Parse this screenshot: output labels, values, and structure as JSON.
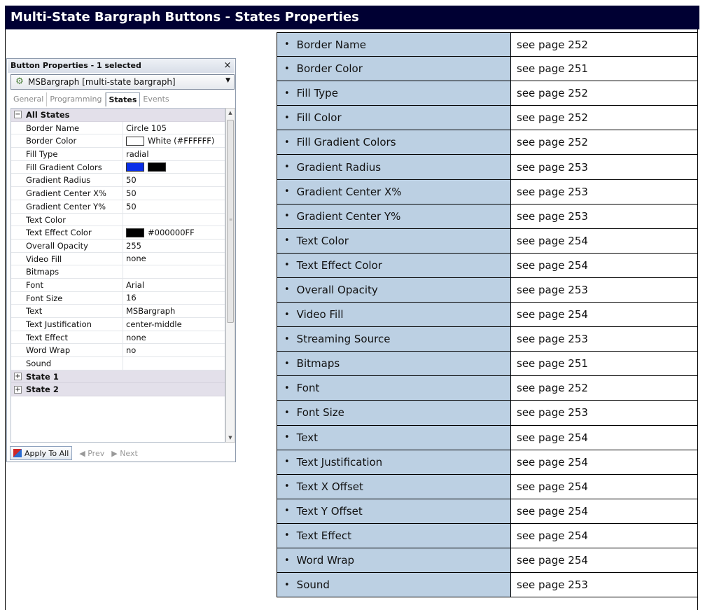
{
  "header": {
    "title": "Multi-State Bargraph Buttons - States Properties"
  },
  "properties_table": {
    "rows": [
      {
        "name": "Border Name",
        "ref": "see page 252"
      },
      {
        "name": "Border Color",
        "ref": "see page 251"
      },
      {
        "name": "Fill Type",
        "ref": "see page 252"
      },
      {
        "name": "Fill Color",
        "ref": "see page 252"
      },
      {
        "name": "Fill Gradient Colors",
        "ref": "see page 252"
      },
      {
        "name": "Gradient Radius",
        "ref": "see page 253"
      },
      {
        "name": "Gradient Center X%",
        "ref": "see page 253"
      },
      {
        "name": "Gradient Center Y%",
        "ref": "see page 253"
      },
      {
        "name": "Text Color",
        "ref": "see page 254"
      },
      {
        "name": "Text Effect Color",
        "ref": "see page 254"
      },
      {
        "name": "Overall Opacity",
        "ref": "see page 253"
      },
      {
        "name": "Video Fill",
        "ref": "see page 254"
      },
      {
        "name": "Streaming Source",
        "ref": "see page 253"
      },
      {
        "name": "Bitmaps",
        "ref": "see page 251"
      },
      {
        "name": "Font",
        "ref": "see page 252"
      },
      {
        "name": "Font Size",
        "ref": "see page 253"
      },
      {
        "name": "Text",
        "ref": "see page 254"
      },
      {
        "name": "Text Justification",
        "ref": "see page 254"
      },
      {
        "name": "Text X Offset",
        "ref": "see page 254"
      },
      {
        "name": "Text Y Offset",
        "ref": "see page 254"
      },
      {
        "name": "Text Effect",
        "ref": "see page 254"
      },
      {
        "name": "Word Wrap",
        "ref": "see page 254"
      },
      {
        "name": "Sound",
        "ref": "see page 253"
      }
    ]
  },
  "panel": {
    "title": "Button Properties - 1 selected",
    "close": "×",
    "dropdown": {
      "value": "MSBargraph  [multi-state bargraph]"
    },
    "tabs": [
      "General",
      "Programming",
      "States",
      "Events"
    ],
    "active_tab": "States",
    "sections": {
      "all_states": "All States",
      "state1": "State 1",
      "state2": "State 2"
    },
    "grid": [
      {
        "name": "Border Name",
        "value": "Circle 105"
      },
      {
        "name": "Border Color",
        "value": "White (#FFFFFF)",
        "swatch": "#ffffff"
      },
      {
        "name": "Fill Type",
        "value": "radial"
      },
      {
        "name": "Fill Gradient Colors",
        "value": "",
        "swatches": [
          "#0a2ee8",
          "#000000"
        ]
      },
      {
        "name": "Gradient Radius",
        "value": "50"
      },
      {
        "name": "Gradient Center X%",
        "value": "50"
      },
      {
        "name": "Gradient Center Y%",
        "value": "50"
      },
      {
        "name": "Text Color",
        "value": ""
      },
      {
        "name": "Text Effect Color",
        "value": "#000000FF",
        "swatch": "#000000"
      },
      {
        "name": "Overall Opacity",
        "value": "255"
      },
      {
        "name": "Video Fill",
        "value": "none"
      },
      {
        "name": "Bitmaps",
        "value": ""
      },
      {
        "name": "Font",
        "value": "Arial"
      },
      {
        "name": "Font Size",
        "value": "16"
      },
      {
        "name": "Text",
        "value": "MSBargraph"
      },
      {
        "name": "Text Justification",
        "value": "center-middle"
      },
      {
        "name": "Text Effect",
        "value": "none"
      },
      {
        "name": "Word Wrap",
        "value": "no"
      },
      {
        "name": "Sound",
        "value": ""
      }
    ],
    "bottom": {
      "apply_label": "Apply To All",
      "prev_label": "◀  Prev",
      "next_label": "▶  Next"
    }
  },
  "colors": {
    "header_bg": "#000033",
    "table_name_bg": "#bcd0e3",
    "section_bg": "#e3e0ea"
  }
}
